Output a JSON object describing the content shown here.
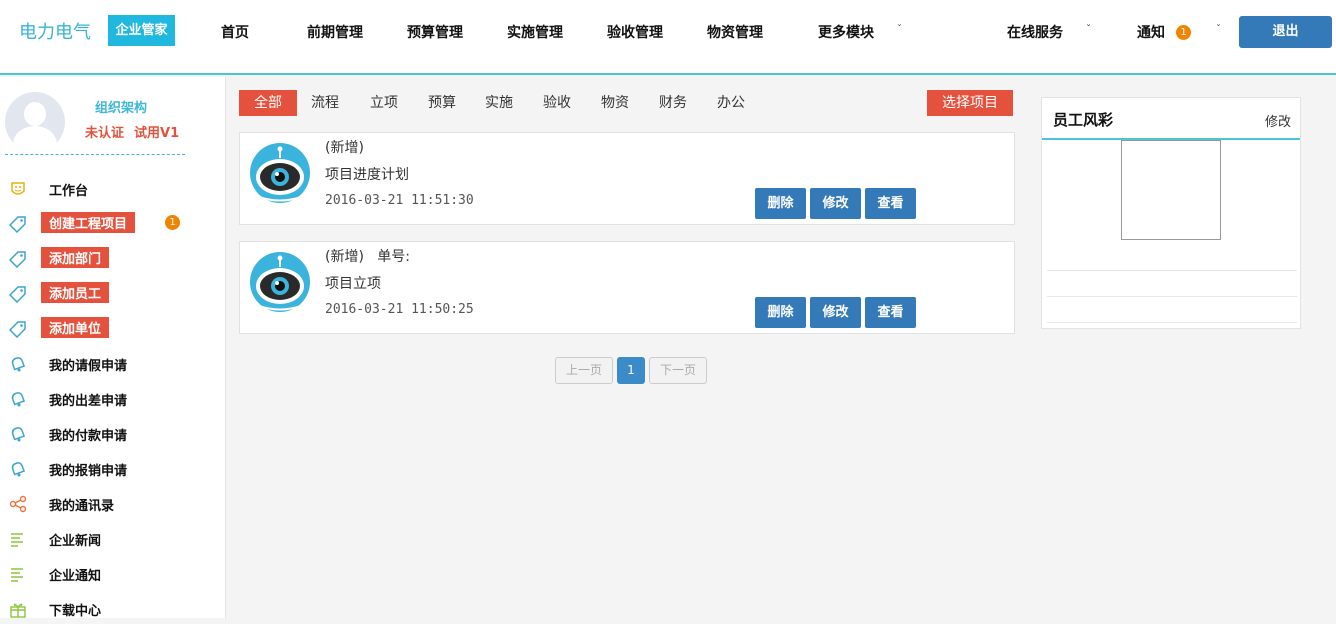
{
  "header": {
    "brand": "电力电气",
    "brand_badge": "企业管家",
    "nav": [
      "首页",
      "前期管理",
      "预算管理",
      "实施管理",
      "验收管理",
      "物资管理",
      "更多模块"
    ],
    "online_service": "在线服务",
    "notice": "通知",
    "notice_count": "1",
    "logout": "退出"
  },
  "profile": {
    "org_link": "组织架构",
    "status": "未认证",
    "version": "试用V1"
  },
  "sidebar": {
    "items": [
      {
        "label": "工作台",
        "icon": "smiley-badge-icon",
        "style": "plain"
      },
      {
        "label": "创建工程项目",
        "icon": "tag-icon",
        "style": "tag",
        "badge": "1"
      },
      {
        "label": "添加部门",
        "icon": "tag-icon",
        "style": "tag"
      },
      {
        "label": "添加员工",
        "icon": "tag-icon",
        "style": "tag"
      },
      {
        "label": "添加单位",
        "icon": "tag-icon",
        "style": "tag"
      },
      {
        "label": "我的请假申请",
        "icon": "bell-icon",
        "style": "plain"
      },
      {
        "label": "我的出差申请",
        "icon": "bell-icon",
        "style": "plain"
      },
      {
        "label": "我的付款申请",
        "icon": "bell-icon",
        "style": "plain"
      },
      {
        "label": "我的报销申请",
        "icon": "bell-icon",
        "style": "plain"
      },
      {
        "label": "我的通讯录",
        "icon": "share-icon",
        "style": "plain"
      },
      {
        "label": "企业新闻",
        "icon": "list-icon",
        "style": "plain"
      },
      {
        "label": "企业通知",
        "icon": "list-icon",
        "style": "plain"
      },
      {
        "label": "下载中心",
        "icon": "gift-icon",
        "style": "plain"
      }
    ]
  },
  "tabs": [
    "全部",
    "流程",
    "立项",
    "预算",
    "实施",
    "验收",
    "物资",
    "财务",
    "办公"
  ],
  "select_project": "选择项目",
  "cards": [
    {
      "line1": "(新增)",
      "title": "项目进度计划",
      "time": "2016-03-21 11:51:30"
    },
    {
      "line1": "(新增)   单号:",
      "title": "项目立项",
      "time": "2016-03-21 11:50:25"
    }
  ],
  "card_buttons": {
    "delete": "删除",
    "edit": "修改",
    "view": "查看"
  },
  "pager": {
    "prev": "上一页",
    "page": "1",
    "next": "下一页"
  },
  "staff": {
    "title": "员工风彩",
    "edit": "修改"
  },
  "colors": {
    "accent": "#3479b8",
    "red": "#e4523d",
    "cyan": "#4cc3d9",
    "orange": "#f08300"
  }
}
